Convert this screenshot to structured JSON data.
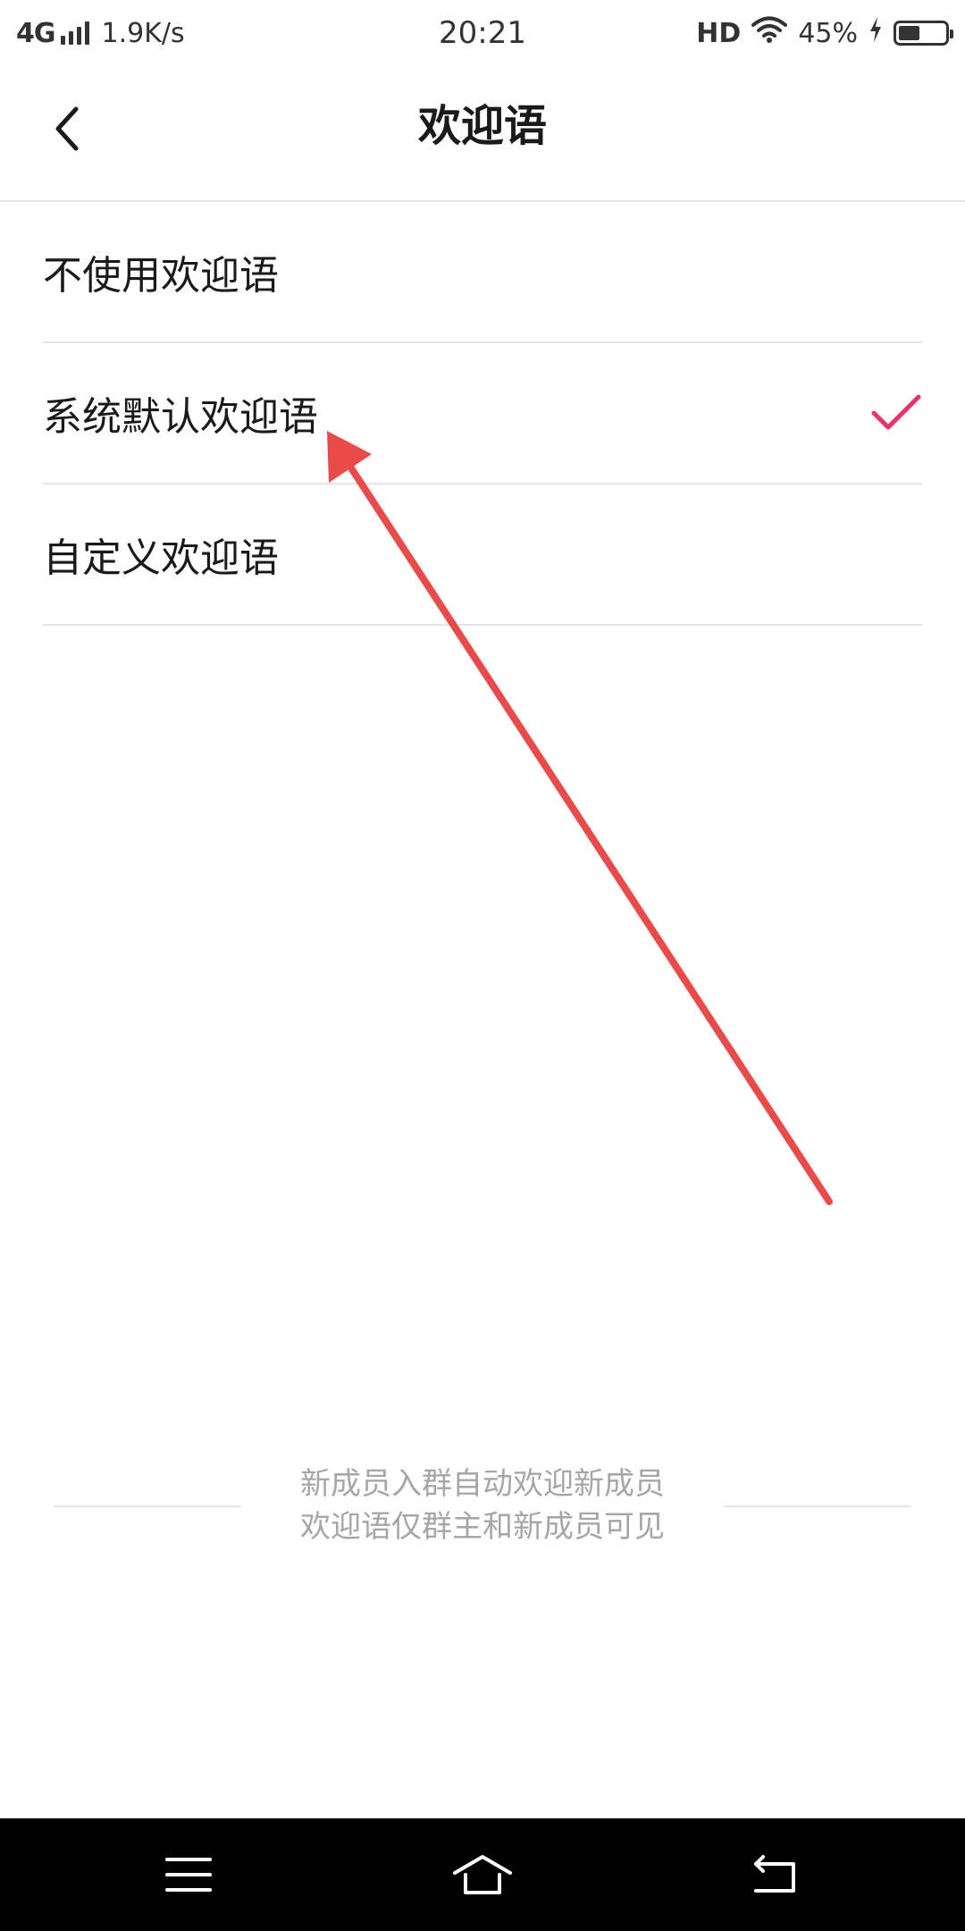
{
  "status_bar": {
    "network": "4G",
    "speed": "1.9K/s",
    "time": "20:21",
    "hd": "HD",
    "battery_text": "45%",
    "battery_level": 0.45,
    "icons": [
      "signal-bars-icon",
      "wifi-icon",
      "charging-bolt-icon",
      "battery-icon"
    ]
  },
  "header": {
    "title": "欢迎语",
    "back_icon": "chevron-left-icon"
  },
  "options": [
    {
      "label": "不使用欢迎语",
      "selected": false
    },
    {
      "label": "系统默认欢迎语",
      "selected": true
    },
    {
      "label": "自定义欢迎语",
      "selected": false
    }
  ],
  "note": {
    "line1": "新成员入群自动欢迎新成员",
    "line2": "欢迎语仅群主和新成员可见"
  },
  "colors": {
    "accent": "#E8336B",
    "annotation_arrow": "#E94B4B",
    "divider": "#E6E6E6",
    "muted_text": "#A6A6A6",
    "nav_bar": "#000000"
  },
  "nav_bar": {
    "icons": [
      "menu-icon",
      "home-icon",
      "back-icon"
    ]
  }
}
